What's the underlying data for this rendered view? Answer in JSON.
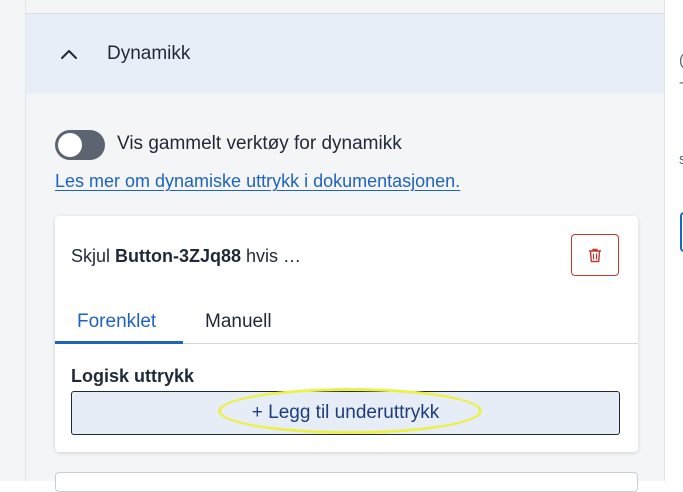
{
  "section": {
    "title": "Dynamikk"
  },
  "toggle": {
    "label": "Vis gammelt verktøy for dynamikk",
    "enabled": false
  },
  "doc_link": {
    "text": "Les mer om dynamiske uttrykk i dokumentasjonen."
  },
  "card": {
    "title_prefix": "Skjul",
    "title_component": "Button-3ZJq88",
    "title_suffix": "hvis …",
    "tabs": [
      {
        "label": "Forenklet",
        "active": true
      },
      {
        "label": "Manuell",
        "active": false
      }
    ],
    "logic_label": "Logisk uttrykk",
    "add_button_label": "+ Legg til underuttrykk"
  },
  "right_pane": {
    "partial_chars": [
      "(",
      "-",
      "s"
    ]
  },
  "colors": {
    "accent": "#1f63bf",
    "danger": "#c0392b",
    "header_bg": "#e8eef7",
    "highlight": "#eef04a"
  }
}
